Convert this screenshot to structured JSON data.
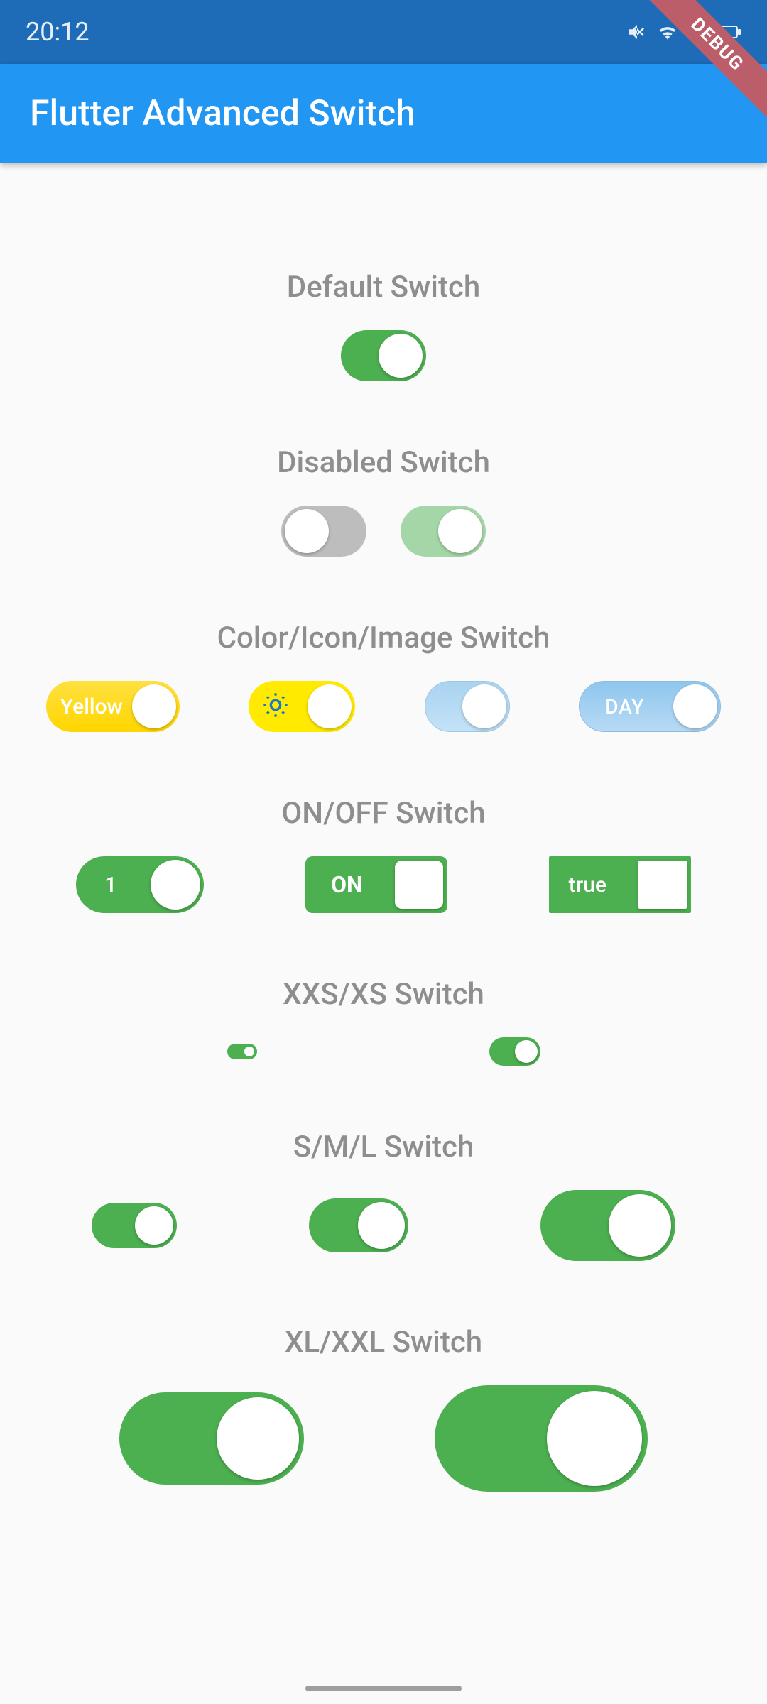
{
  "status_bar": {
    "time": "20:12"
  },
  "app_bar": {
    "title": "Flutter Advanced Switch"
  },
  "debug": {
    "label": "DEBUG"
  },
  "sections": {
    "default": "Default Switch",
    "disabled": "Disabled Switch",
    "color": "Color/Icon/Image Switch",
    "onoff": "ON/OFF Switch",
    "xxs": "XXS/XS Switch",
    "sml": "S/M/L Switch",
    "xl": "XL/XXL Switch"
  },
  "switches": {
    "yellow_label": "Yellow",
    "day_label": "DAY",
    "num_label": "1",
    "on_label": "ON",
    "true_label": "true"
  },
  "colors": {
    "status_bar": "#1e6bb8",
    "app_bar": "#2196f3",
    "green": "#4caf50",
    "green_disabled": "#a5d6a7",
    "grey": "#bdbdbd",
    "yellow": "#ffea00",
    "sky": "#a9d3f0"
  }
}
